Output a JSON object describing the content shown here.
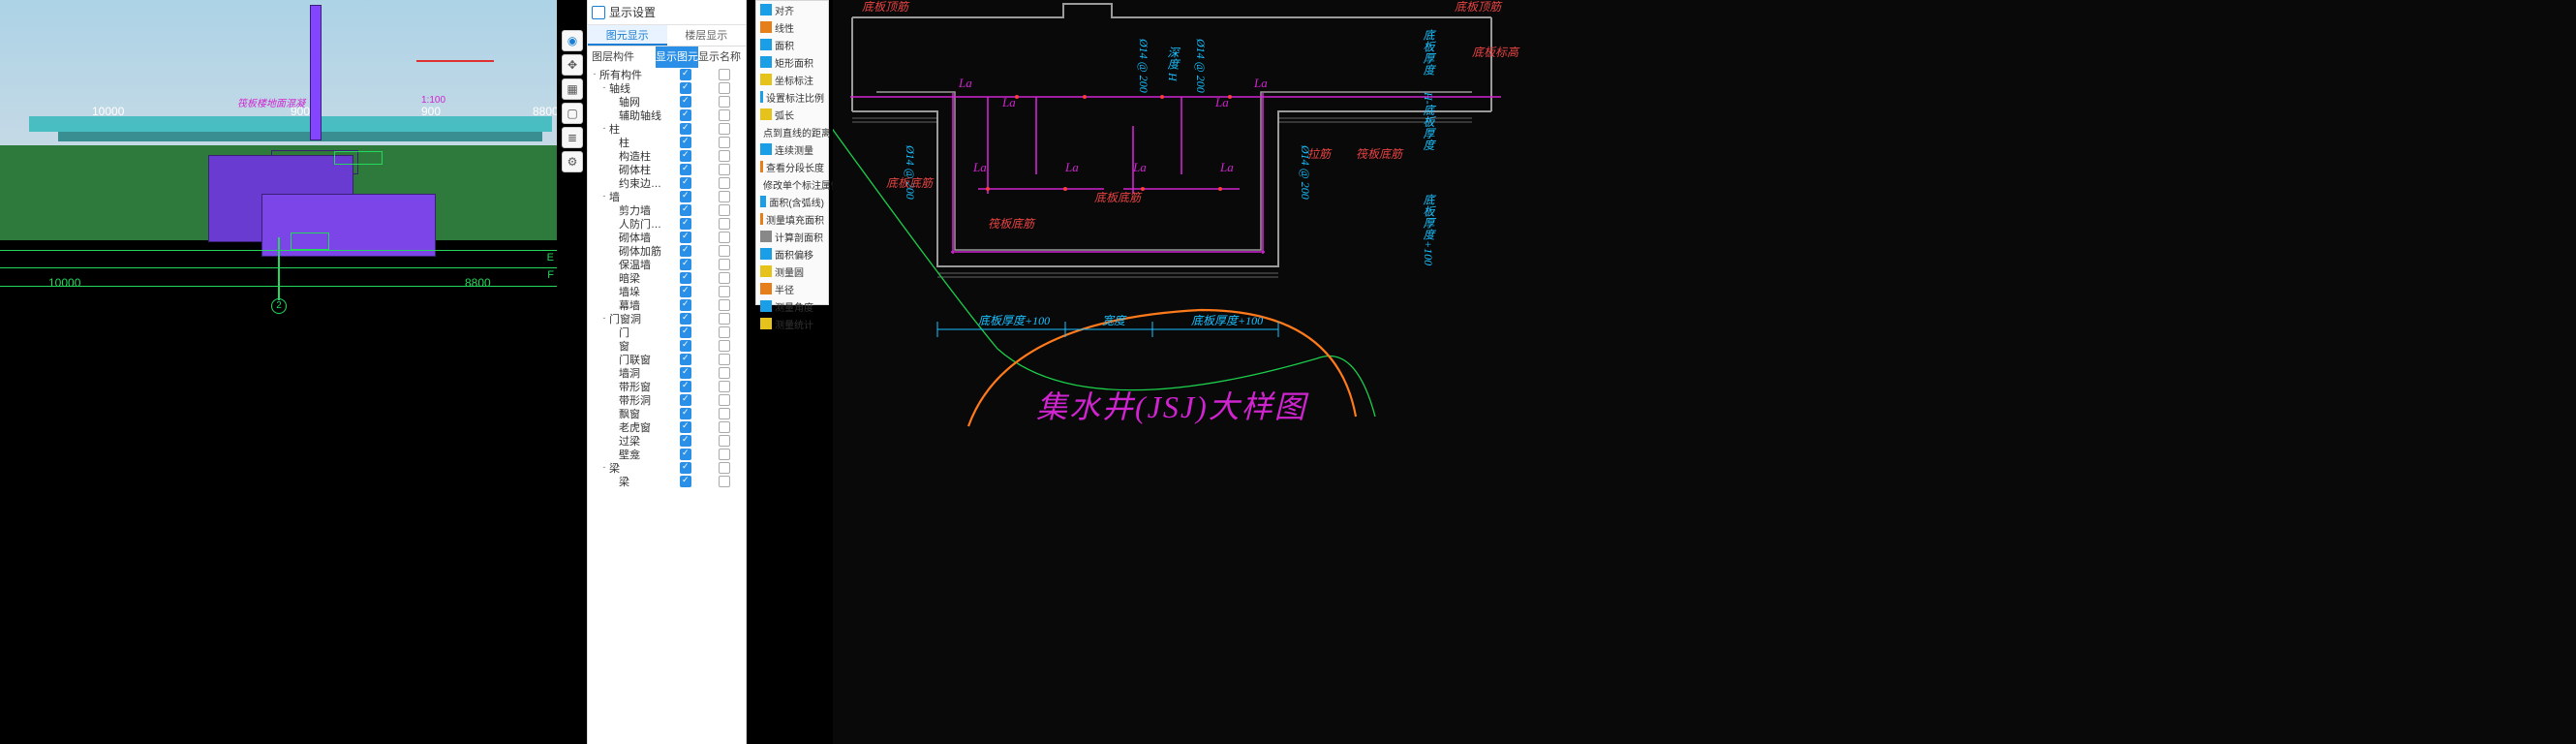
{
  "left_view": {
    "note": "筏板楼地面混凝",
    "scale": "1:100",
    "dim_top_left": "10000",
    "dim_top_mid": "900",
    "dim_top_right": "8800",
    "dim_small_900a": "900",
    "dim_bottom_left": "10000",
    "dim_bottom_right": "8800",
    "axis_e": "E",
    "axis_f": "F",
    "bubble": "2"
  },
  "panel": {
    "title": "显示设置",
    "tabs": [
      "图元显示",
      "楼层显示"
    ],
    "cols": [
      "图层构件",
      "显示图元",
      "显示名称"
    ],
    "tree": [
      {
        "d": 0,
        "exp": "-",
        "label": "所有构件",
        "c1": true,
        "c2": false
      },
      {
        "d": 1,
        "exp": "-",
        "label": "轴线",
        "c1": true,
        "c2": false
      },
      {
        "d": 2,
        "exp": "",
        "label": "轴网",
        "c1": true,
        "c2": false
      },
      {
        "d": 2,
        "exp": "",
        "label": "辅助轴线",
        "c1": true,
        "c2": false
      },
      {
        "d": 1,
        "exp": "-",
        "label": "柱",
        "c1": true,
        "c2": false
      },
      {
        "d": 2,
        "exp": "",
        "label": "柱",
        "c1": true,
        "c2": false
      },
      {
        "d": 2,
        "exp": "",
        "label": "构造柱",
        "c1": true,
        "c2": false
      },
      {
        "d": 2,
        "exp": "",
        "label": "砌体柱",
        "c1": true,
        "c2": false
      },
      {
        "d": 2,
        "exp": "",
        "label": "约束边缘非阴…",
        "c1": true,
        "c2": false
      },
      {
        "d": 1,
        "exp": "-",
        "label": "墙",
        "c1": true,
        "c2": false
      },
      {
        "d": 2,
        "exp": "",
        "label": "剪力墙",
        "c1": true,
        "c2": false
      },
      {
        "d": 2,
        "exp": "",
        "label": "人防门框墙",
        "c1": true,
        "c2": false
      },
      {
        "d": 2,
        "exp": "",
        "label": "砌体墙",
        "c1": true,
        "c2": false
      },
      {
        "d": 2,
        "exp": "",
        "label": "砌体加筋",
        "c1": true,
        "c2": false
      },
      {
        "d": 2,
        "exp": "",
        "label": "保温墙",
        "c1": true,
        "c2": false
      },
      {
        "d": 2,
        "exp": "",
        "label": "暗梁",
        "c1": true,
        "c2": false
      },
      {
        "d": 2,
        "exp": "",
        "label": "墙垛",
        "c1": true,
        "c2": false
      },
      {
        "d": 2,
        "exp": "",
        "label": "幕墙",
        "c1": true,
        "c2": false
      },
      {
        "d": 1,
        "exp": "-",
        "label": "门窗洞",
        "c1": true,
        "c2": false
      },
      {
        "d": 2,
        "exp": "",
        "label": "门",
        "c1": true,
        "c2": false
      },
      {
        "d": 2,
        "exp": "",
        "label": "窗",
        "c1": true,
        "c2": false
      },
      {
        "d": 2,
        "exp": "",
        "label": "门联窗",
        "c1": true,
        "c2": false
      },
      {
        "d": 2,
        "exp": "",
        "label": "墙洞",
        "c1": true,
        "c2": false
      },
      {
        "d": 2,
        "exp": "",
        "label": "带形窗",
        "c1": true,
        "c2": false
      },
      {
        "d": 2,
        "exp": "",
        "label": "带形洞",
        "c1": true,
        "c2": false
      },
      {
        "d": 2,
        "exp": "",
        "label": "飘窗",
        "c1": true,
        "c2": false
      },
      {
        "d": 2,
        "exp": "",
        "label": "老虎窗",
        "c1": true,
        "c2": false
      },
      {
        "d": 2,
        "exp": "",
        "label": "过梁",
        "c1": true,
        "c2": false
      },
      {
        "d": 2,
        "exp": "",
        "label": "壁龛",
        "c1": true,
        "c2": false
      },
      {
        "d": 1,
        "exp": "-",
        "label": "梁",
        "c1": true,
        "c2": false
      },
      {
        "d": 2,
        "exp": "",
        "label": "梁",
        "c1": true,
        "c2": false
      }
    ]
  },
  "measure": [
    {
      "icon": "#1a9ee6",
      "label": "对齐"
    },
    {
      "icon": "#e67e1a",
      "label": "线性"
    },
    {
      "icon": "#1a9ee6",
      "label": "面积"
    },
    {
      "icon": "#1a9ee6",
      "label": "矩形面积"
    },
    {
      "icon": "#e6c31a",
      "label": "坐标标注"
    },
    {
      "icon": "#1a9ee6",
      "label": "设置标注比例"
    },
    {
      "icon": "#e6c31a",
      "label": "弧长"
    },
    {
      "icon": "#e6c31a",
      "label": "点到直线的距离"
    },
    {
      "icon": "#1a9ee6",
      "label": "连续测量"
    },
    {
      "icon": "#e67e1a",
      "label": "查看分段长度"
    },
    {
      "icon": "#e6c31a",
      "label": "修改单个标注属性"
    },
    {
      "icon": "#1a9ee6",
      "label": "面积(含弧线)"
    },
    {
      "icon": "#e67e1a",
      "label": "测量填充面积"
    },
    {
      "icon": "#888",
      "label": "计算剖面积"
    },
    {
      "icon": "#1a9ee6",
      "label": "面积偏移"
    },
    {
      "icon": "#e6c31a",
      "label": "测量圆"
    },
    {
      "icon": "#e67e1a",
      "label": "半径"
    },
    {
      "icon": "#1a9ee6",
      "label": "测量角度"
    },
    {
      "icon": "#e6c31a",
      "label": "测量统计"
    }
  ],
  "cad": {
    "title": "集水井(JSJ)大样图",
    "labels": {
      "rebar": "Ø14 @ 200",
      "la": "La",
      "bottom_rebar": "底板底筋",
      "mat_bottom_rebar": "筏板底筋",
      "thickness_plus": "底板厚度+100",
      "width": "宽度",
      "top_right": "底板顶筋",
      "right_thick": "底板厚度",
      "right_h_thick": "H-底板厚度",
      "right_mark": "底板标高",
      "tie": "拉筋",
      "deep_h": "深度 H"
    }
  }
}
